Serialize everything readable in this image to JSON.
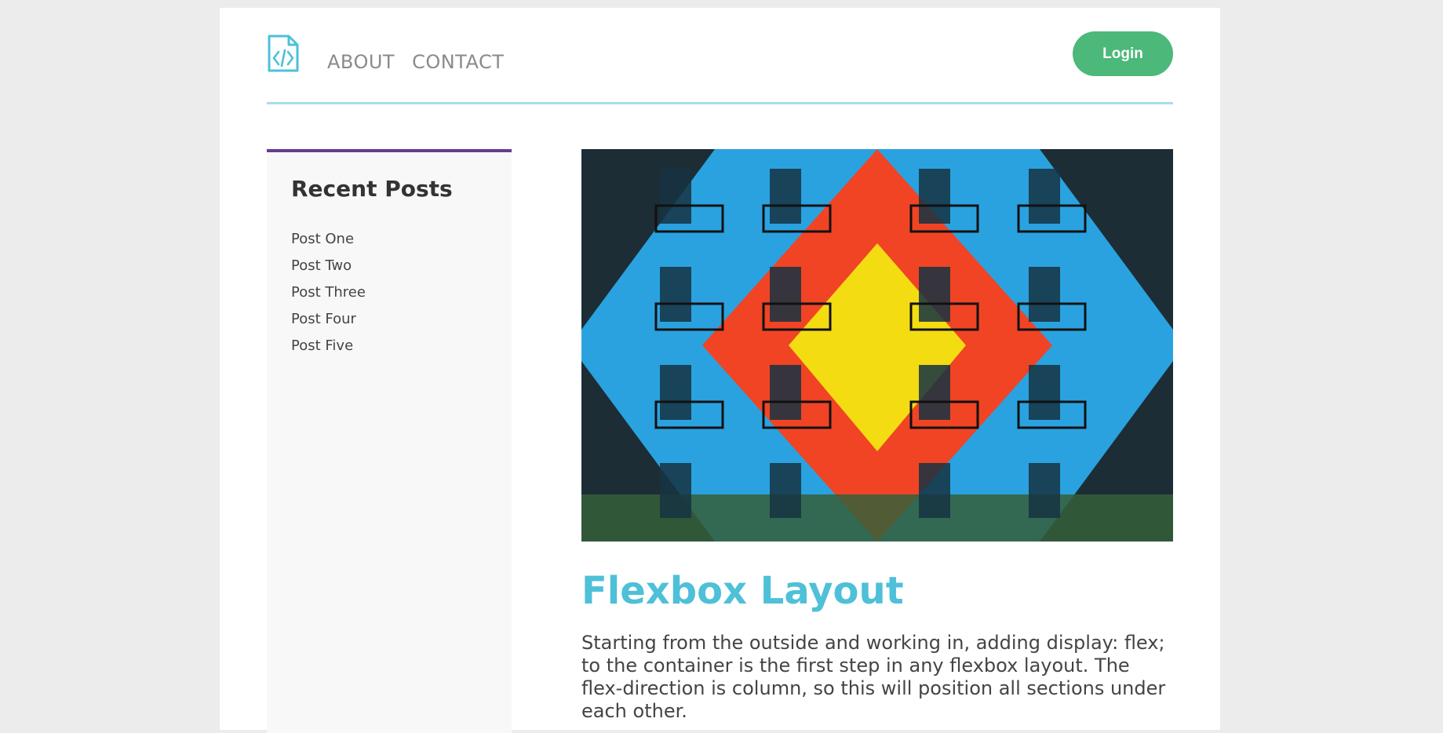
{
  "nav": {
    "items": [
      "ABOUT",
      "CONTACT"
    ],
    "login_label": "Login"
  },
  "sidebar": {
    "title": "Recent Posts",
    "posts": [
      "Post One",
      "Post Two",
      "Post Three",
      "Post Four",
      "Post Five"
    ]
  },
  "article": {
    "title": "Flexbox Layout",
    "body": "Starting from the outside and working in, adding display: flex; to the container is the first step in any flexbox layout. The flex-direction is column, so this will position all sections under each other."
  },
  "icons": {
    "logo": "code-file-icon"
  },
  "colors": {
    "accent": "#4ec0d8",
    "login": "#4cb879",
    "sidebar_top": "#663d8c",
    "divider": "#a8dde9"
  }
}
